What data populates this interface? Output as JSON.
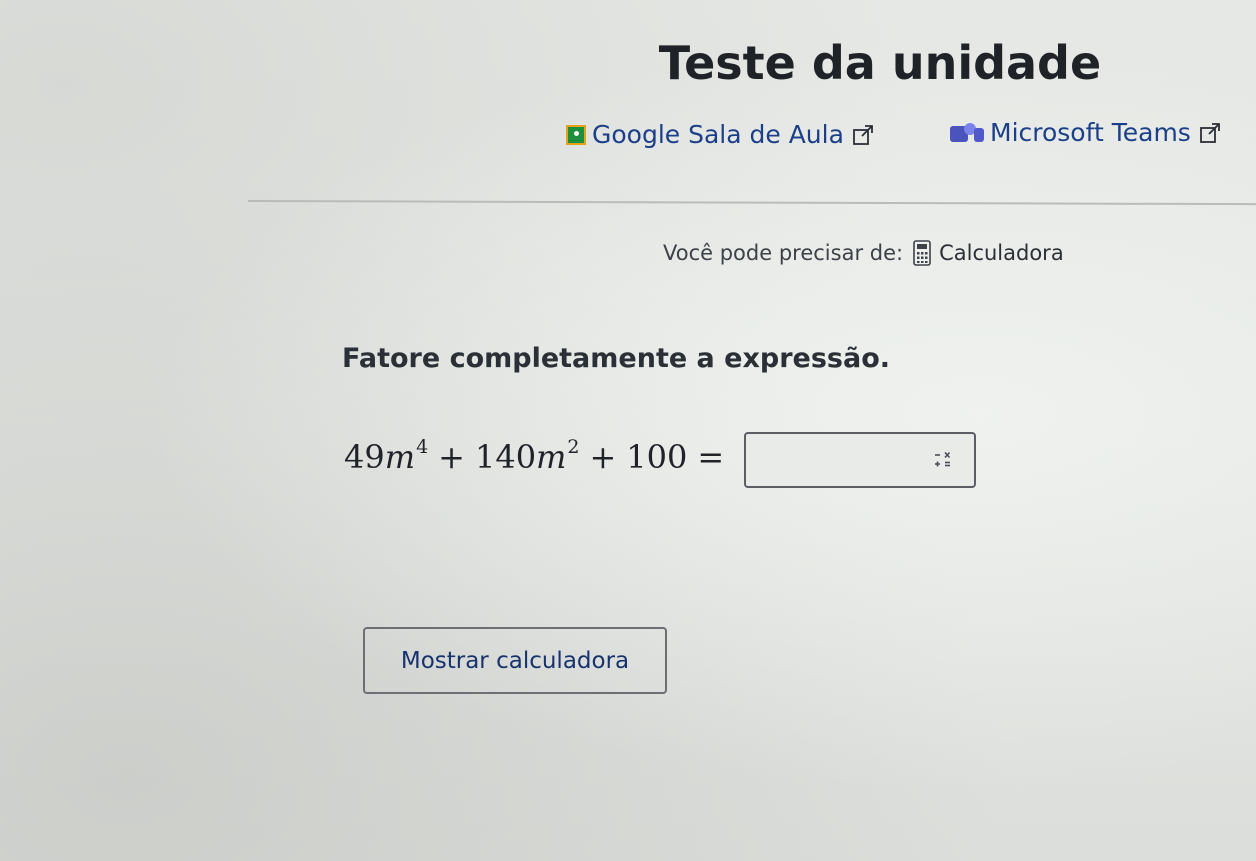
{
  "header": {
    "title": "Teste da unidade",
    "share_links": {
      "classroom": {
        "label": "Google Sala de Aula",
        "icon": "google-classroom-icon",
        "external_icon": "external-link-icon"
      },
      "teams": {
        "label": "Microsoft Teams",
        "icon": "microsoft-teams-icon",
        "external_icon": "external-link-icon"
      }
    }
  },
  "tools": {
    "prefix": "Você pode precisar de:",
    "calculator_label": "Calculadora",
    "icon": "calculator-icon"
  },
  "question": {
    "prompt": "Fatore completamente a expressão.",
    "expression": {
      "term1_coef": "49",
      "term1_var": "m",
      "term1_exp": "4",
      "op1": "+",
      "term2_coef": "140",
      "term2_var": "m",
      "term2_exp": "2",
      "op2": "+",
      "constant": "100",
      "equals": "="
    },
    "answer": {
      "value": "",
      "keypad_icon": "math-keypad-icon"
    }
  },
  "actions": {
    "show_calculator_label": "Mostrar calculadora"
  },
  "colors": {
    "link": "#1c3f8a",
    "button_text": "#17336e",
    "background": "#e4e6e3"
  }
}
